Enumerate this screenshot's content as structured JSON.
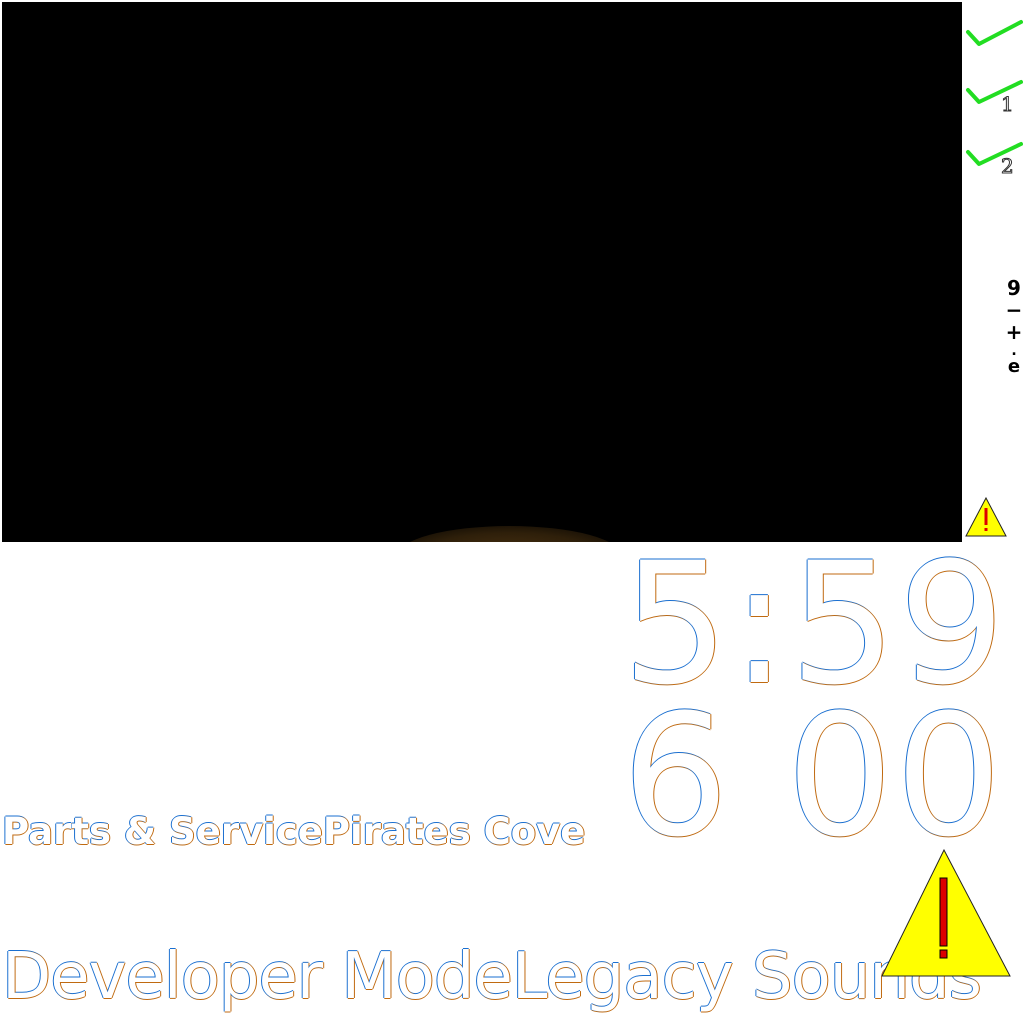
{
  "checks": [
    {
      "icon": "check-icon",
      "number": ""
    },
    {
      "icon": "check-icon",
      "number": "1"
    },
    {
      "icon": "check-icon",
      "number": "2"
    }
  ],
  "mini_stack": [
    "9",
    "−",
    "+",
    ".",
    "e"
  ],
  "clock": {
    "current": "5:59",
    "next": "6 00"
  },
  "locations": {
    "first": "Parts & Service",
    "second": "Pirates Cove"
  },
  "modes": {
    "first": "Developer Mode",
    "second": "Legacy Sounds"
  },
  "colors": {
    "check": "#22dd22",
    "warning_fill": "#ffff00",
    "warning_mark": "#dd0000",
    "viewport": "#000000"
  }
}
